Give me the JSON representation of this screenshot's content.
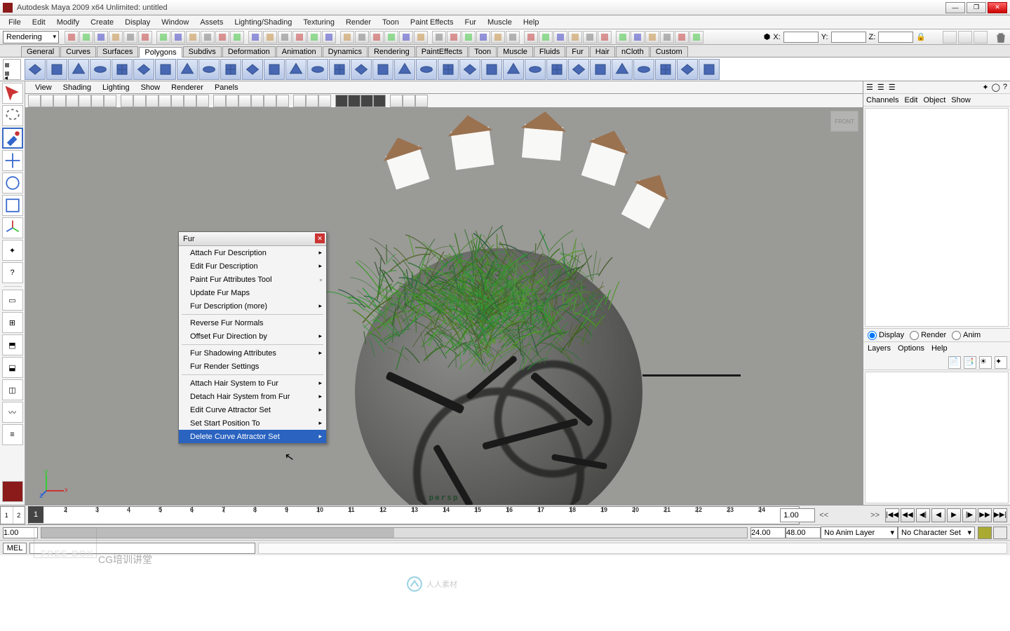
{
  "window": {
    "title": "Autodesk Maya 2009 x64 Unlimited: untitled"
  },
  "menubar": [
    "File",
    "Edit",
    "Modify",
    "Create",
    "Display",
    "Window",
    "Assets",
    "Lighting/Shading",
    "Texturing",
    "Render",
    "Toon",
    "Paint Effects",
    "Fur",
    "Muscle",
    "Help"
  ],
  "workspace_dropdown": "Rendering",
  "coords": {
    "x": "X:",
    "y": "Y:",
    "z": "Z:"
  },
  "shelf_tabs": [
    "General",
    "Curves",
    "Surfaces",
    "Polygons",
    "Subdivs",
    "Deformation",
    "Animation",
    "Dynamics",
    "Rendering",
    "PaintEffects",
    "Toon",
    "Muscle",
    "Fluids",
    "Fur",
    "Hair",
    "nCloth",
    "Custom"
  ],
  "shelf_active": 3,
  "viewport_menu": [
    "View",
    "Shading",
    "Lighting",
    "Show",
    "Renderer",
    "Panels"
  ],
  "persp_label": "persp",
  "viewcube": "FRONT",
  "fur_menu": {
    "title": "Fur",
    "items": [
      {
        "t": "Attach Fur Description",
        "sub": true
      },
      {
        "t": "Edit Fur Description",
        "sub": true
      },
      {
        "t": "Paint Fur Attributes Tool",
        "box": true
      },
      {
        "t": "Update Fur Maps"
      },
      {
        "t": "Fur Description (more)",
        "sub": true
      },
      {
        "t": "-"
      },
      {
        "t": "Reverse Fur Normals"
      },
      {
        "t": "Offset Fur Direction by",
        "sub": true
      },
      {
        "t": "-"
      },
      {
        "t": "Fur Shadowing Attributes",
        "sub": true
      },
      {
        "t": "Fur Render Settings"
      },
      {
        "t": "-"
      },
      {
        "t": "Attach Hair System to Fur",
        "sub": true
      },
      {
        "t": "Detach Hair System from Fur",
        "sub": true
      },
      {
        "t": "Edit Curve Attractor Set",
        "sub": true
      },
      {
        "t": "Set Start Position To",
        "sub": true
      },
      {
        "t": "Delete Curve Attractor Set",
        "sub": true,
        "sel": true
      }
    ]
  },
  "channel_tabs": [
    "Channels",
    "Edit",
    "Object",
    "Show"
  ],
  "display_radios": {
    "display": "Display",
    "render": "Render",
    "anim": "Anim"
  },
  "layer_menu": [
    "Layers",
    "Options",
    "Help"
  ],
  "timeline": {
    "labels": [
      "1",
      "2",
      "3",
      "4",
      "5",
      "6",
      "7",
      "8",
      "9",
      "10",
      "11",
      "12",
      "13",
      "14",
      "15",
      "16",
      "17",
      "18",
      "19",
      "20",
      "21",
      "22",
      "23",
      "24"
    ],
    "current": "1",
    "range_start": "1.00",
    "range_end_inner": "24.00",
    "range_end_outer": "48.00",
    "end_right": "1.00",
    "nav_left": "<<",
    "nav_right": ">>"
  },
  "anim_layer": "No Anim Layer",
  "char_set": "No Character Set",
  "cmd": {
    "label": "MEL"
  },
  "watermark": "人人素材",
  "watermark2": "CG培训讲堂",
  "freebox": "FREE-BOX"
}
